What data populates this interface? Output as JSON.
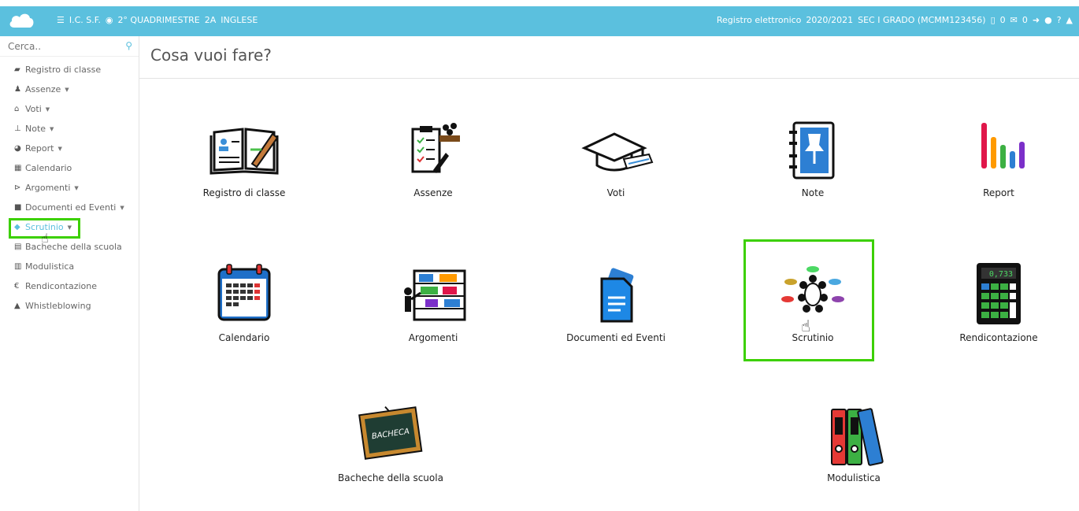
{
  "topbar": {
    "menu_icon": "hamburger-icon",
    "school": "I.C. S.F.",
    "period": "2° QUADRIMESTRE",
    "class": "2A",
    "subject": "INGLESE",
    "app_name": "Registro elettronico",
    "year": "2020/2021",
    "school_type": "SEC I GRADO (MCMM123456)",
    "docs_count": "0",
    "mail_count": "0",
    "color": "#5bc0de"
  },
  "sidebar": {
    "search_placeholder": "Cerca..",
    "items": [
      {
        "label": "Registro di classe",
        "icon": "book-icon",
        "caret": ""
      },
      {
        "label": "Assenze",
        "icon": "user-icon",
        "caret": "▼"
      },
      {
        "label": "Voti",
        "icon": "bank-icon",
        "caret": "▼"
      },
      {
        "label": "Note",
        "icon": "pin-icon",
        "caret": "▼"
      },
      {
        "label": "Report",
        "icon": "pie-chart-icon",
        "caret": "▼"
      },
      {
        "label": "Calendario",
        "icon": "calendar-icon",
        "caret": ""
      },
      {
        "label": "Argomenti",
        "icon": "folder-open-icon",
        "caret": "▼"
      },
      {
        "label": "Documenti ed Eventi",
        "icon": "archive-icon",
        "caret": "▼"
      },
      {
        "label": "Scrutinio",
        "icon": "graduation-cap-icon",
        "caret": "▼"
      },
      {
        "label": "Bacheche della scuola",
        "icon": "list-icon",
        "caret": ""
      },
      {
        "label": "Modulistica",
        "icon": "newspaper-icon",
        "caret": ""
      },
      {
        "label": "Rendicontazione",
        "icon": "euro-icon",
        "caret": ""
      },
      {
        "label": "Whistleblowing",
        "icon": "lock-icon",
        "caret": ""
      }
    ]
  },
  "main": {
    "title": "Cosa vuoi fare?",
    "tiles": [
      {
        "label": "Registro di classe"
      },
      {
        "label": "Assenze"
      },
      {
        "label": "Voti"
      },
      {
        "label": "Note"
      },
      {
        "label": "Report"
      },
      {
        "label": "Calendario"
      },
      {
        "label": "Argomenti"
      },
      {
        "label": "Documenti ed Eventi"
      },
      {
        "label": "Scrutinio"
      },
      {
        "label": "Rendicontazione"
      },
      {
        "label": "Bacheche della scuola"
      },
      {
        "label": "Modulistica"
      }
    ],
    "calculator_display": "0,733",
    "bacheca_text": "BACHECA"
  },
  "colors": {
    "highlight": "#3cd000",
    "accent": "#5bc0de"
  }
}
